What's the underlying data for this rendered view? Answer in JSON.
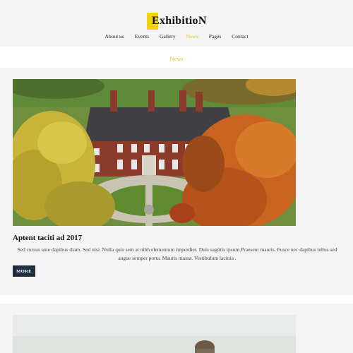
{
  "brand": {
    "name": "ExhibitioN",
    "accent": "#f2d20a"
  },
  "nav": {
    "items": [
      {
        "label": "About us",
        "active": false
      },
      {
        "label": "Events",
        "active": false
      },
      {
        "label": "Gallery",
        "active": false
      },
      {
        "label": "News",
        "active": true
      },
      {
        "label": "Pages",
        "active": false
      },
      {
        "label": "Contact",
        "active": false
      }
    ]
  },
  "section": {
    "title": "News",
    "title_color": "#e7c21d"
  },
  "posts": [
    {
      "title": "Aptent taciti ad 2017",
      "body": "Sed cursus ante dapibus diam. Sed nisi. Nulla quis sem at nibh elementum imperdiet. Duis sagittis ipsum.Praesent mauris. Fusce nec dapibus tellus sed augue semper porta. Mauris massa. Vestibulum lacinia .",
      "more_label": "MORE",
      "image": "country-manor-autumn-photo"
    },
    {
      "image": "outdoor-photo-partial"
    }
  ],
  "colors": {
    "button_bg": "#1f2f43",
    "page_bg": "#f4f4f4"
  }
}
